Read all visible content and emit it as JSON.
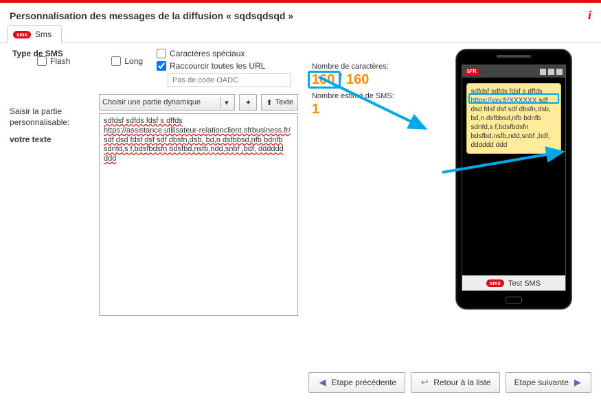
{
  "header": {
    "title": "Personnalisation des messages de la diffusion « sqdsqdsqd »"
  },
  "tab": {
    "label": "Sms",
    "icon": "sms"
  },
  "type": {
    "label": "Type de SMS",
    "flash": "Flash",
    "long": "Long",
    "special": "Caractères spéciaux",
    "shorten": "Raccourcir toutes les URL",
    "shorten_checked": true,
    "oadc_placeholder": "Pas de code OADC"
  },
  "perso": {
    "label1": "Saisir la partie",
    "label2": "personnalisable:",
    "label3": "votre texte",
    "dyn_placeholder": "Choisir une partie dynamique",
    "btn_text": "Texte"
  },
  "message_parts": {
    "l1": "sdfdsf sdfds fdsf s dffds",
    "l2": "https://assistance.utilisateur-relationclient.sfrbusiness.fr/",
    "l3": "sdf dsd fdsf dsf sdf dbsfn,dsb, bd,n dsfbbsd,nfb bdnfb",
    "l4": "sdnfd,s f,bdsfbdsfn bdsfbd,nsfb,ndd,snbf ,bdf, dddddd",
    "l5": "ddd"
  },
  "counter": {
    "chars_label": "Nombre de caractères:",
    "chars_value": "160 / 160",
    "sms_label": "Nombre estimé de SMS:",
    "sms_value": "1"
  },
  "preview": {
    "carrier": "SFR",
    "l1": "sdfdsf sdfds fdsf s dffds",
    "link": "https://vxy.fr/XXXXXX",
    "l2": "sdf dsd fdsf dsf sdf dbsfn,dsb, bd,n dsfbbsd,nfb bdnfb sdnfd,s f,bdsfbdsfn bdsfbd,nsfb,ndd,snbf ,bdf, dddddd ddd",
    "footer": "Test SMS"
  },
  "nav": {
    "prev": "Etape précédente",
    "list": "Retour à la liste",
    "next": "Etape suivante"
  }
}
